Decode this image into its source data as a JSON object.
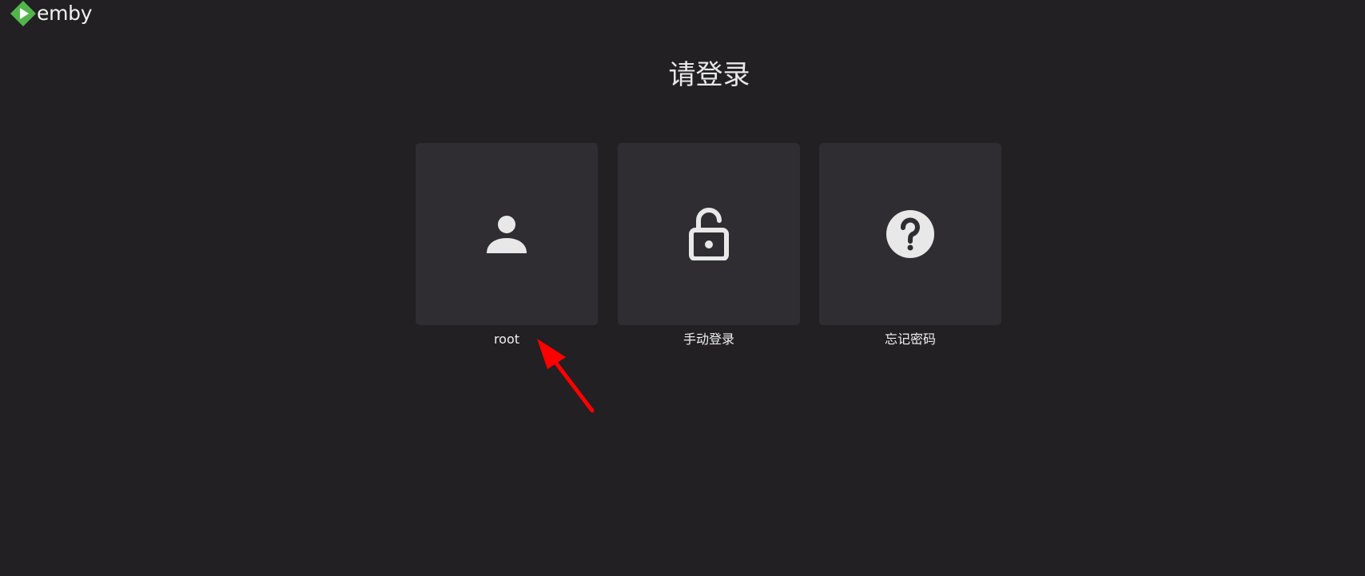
{
  "brand": {
    "name": "emby",
    "accent": "#52b54b"
  },
  "header": {
    "title": "请登录"
  },
  "options": [
    {
      "label": "root",
      "icon": "person-icon"
    },
    {
      "label": "手动登录",
      "icon": "lock-open-icon"
    },
    {
      "label": "忘记密码",
      "icon": "help-icon"
    }
  ],
  "annotation": {
    "arrow_color": "#ff0000"
  }
}
